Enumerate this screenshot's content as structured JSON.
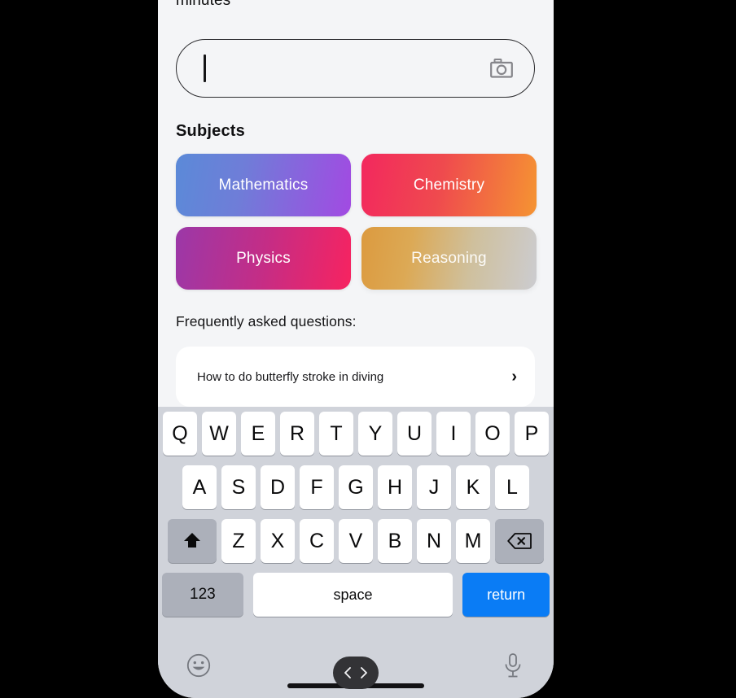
{
  "app": {
    "partial_label": "minutes",
    "input": {
      "value": "",
      "placeholder": "",
      "camera_icon": "camera-icon"
    },
    "subjects_heading": "Subjects",
    "subjects": [
      {
        "label": "Mathematics",
        "gradient_from": "#5b8ad8",
        "gradient_to": "#a24ae2",
        "state": "normal"
      },
      {
        "label": "Chemistry",
        "gradient_from": "#f3285e",
        "gradient_to": "#f59432",
        "state": "normal"
      },
      {
        "label": "Physics",
        "gradient_from": "#9b38a8",
        "gradient_to": "#f72360",
        "state": "normal"
      },
      {
        "label": "Reasoning",
        "gradient_from": "#dc9a3f",
        "gradient_to": "#ccccd0",
        "state": "faded"
      }
    ],
    "faq_heading": "Frequently asked questions:",
    "faq_items": [
      {
        "text": "How to do butterfly stroke in diving",
        "chevron": "›"
      }
    ]
  },
  "keyboard": {
    "row1": [
      "Q",
      "W",
      "E",
      "R",
      "T",
      "Y",
      "U",
      "I",
      "O",
      "P"
    ],
    "row2": [
      "A",
      "S",
      "D",
      "F",
      "G",
      "H",
      "J",
      "K",
      "L"
    ],
    "row3_letters": [
      "Z",
      "X",
      "C",
      "V",
      "B",
      "N",
      "M"
    ],
    "shift_icon": "shift-icon",
    "backspace_icon": "backspace-icon",
    "numbers_key": "123",
    "space_key": "space",
    "return_key": "return",
    "emoji_icon": "emoji-icon",
    "mic_icon": "microphone-icon",
    "return_color": "#0a7cf5",
    "background_color": "#d0d3da"
  },
  "system": {
    "nav_back": "‹",
    "nav_forward": "›",
    "home_indicator": ""
  }
}
